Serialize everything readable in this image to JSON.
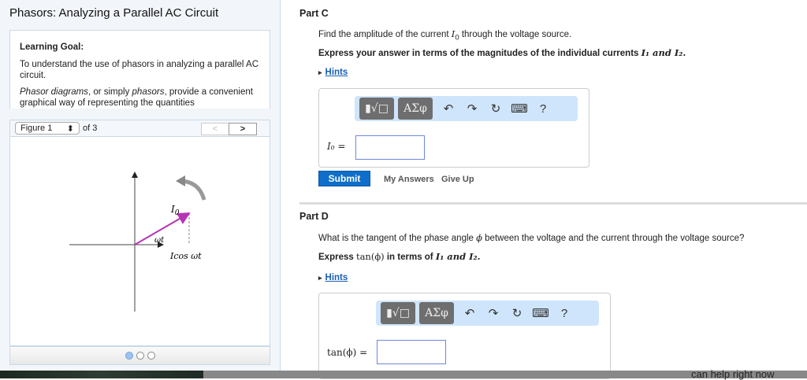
{
  "title": "Phasors: Analyzing a Parallel AC Circuit",
  "goal": {
    "heading": "Learning Goal:",
    "p1": "To understand the use of phasors in analyzing a parallel AC circuit.",
    "p2a": "Phasor diagrams",
    "p2b": ", or simply ",
    "p2c": "phasors",
    "p2d": ", provide a convenient graphical way of representing the quantities"
  },
  "figure": {
    "select": "Figure 1",
    "of": "of 3",
    "prev": "<",
    "next": ">",
    "labels": {
      "i0": "I",
      "i0sub": "0",
      "wt": "ωt",
      "icos": "Icos ωt"
    },
    "phasor_color": "#b535b5",
    "pages": 3,
    "current_page": 1
  },
  "partC": {
    "header": "Part C",
    "question_a": "Find the amplitude of the current ",
    "question_var": "I",
    "question_sub": "0",
    "question_b": " through the voltage source.",
    "express": "Express your answer in terms of the magnitudes of the individual currents ",
    "express_vars": "I₁ and I₂.",
    "hints": "Hints",
    "label": "I₀ =",
    "submit": "Submit",
    "my_answers": "My Answers",
    "give_up": "Give Up"
  },
  "partD": {
    "header": "Part D",
    "question_a": "What is the tangent of the phase angle ",
    "question_var": "ϕ",
    "question_b": " between the voltage and the current through the voltage source?",
    "express_a": "Express ",
    "express_fn": "tan(ϕ)",
    "express_b": " in terms of ",
    "express_vars": "I₁ and I₂.",
    "hints": "Hints",
    "label": "tan(ϕ) ="
  },
  "toolbar": {
    "templates": "▮√□",
    "greek": "ΑΣφ",
    "undo": "↶",
    "redo": "↷",
    "reset": "↻",
    "keyboard": "⌨",
    "help": "?"
  },
  "bottom_caption": "can help right now"
}
